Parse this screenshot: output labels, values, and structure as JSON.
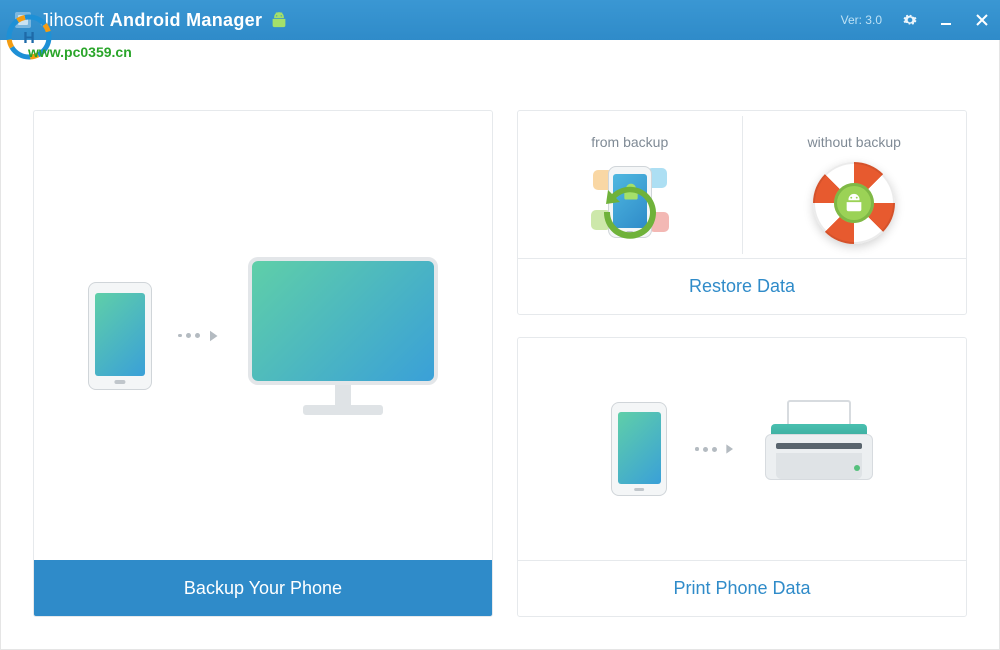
{
  "header": {
    "app_name": "Jihosoft",
    "app_product": "Android Manager",
    "version_label": "Ver: 3.0"
  },
  "watermark": {
    "url": "www.pc0359.cn"
  },
  "cards": {
    "backup": {
      "title": "Backup Your Phone"
    },
    "restore": {
      "title": "Restore Data",
      "from_backup_label": "from backup",
      "without_backup_label": "without backup"
    },
    "print": {
      "title": "Print Phone Data"
    }
  },
  "icons": {
    "android": "android-icon",
    "phone": "phone-icon",
    "monitor": "monitor-icon",
    "arrow_dots": "arrow-dots-icon",
    "lifering": "lifering-icon",
    "printer": "printer-icon",
    "restore_arrow": "restore-arrow-icon",
    "settings": "gear-icon",
    "minimize": "minimize-icon",
    "close": "close-icon"
  },
  "colors": {
    "primary": "#2f8bc9",
    "accent_green": "#9bd256",
    "accent_orange": "#e75a2f"
  }
}
